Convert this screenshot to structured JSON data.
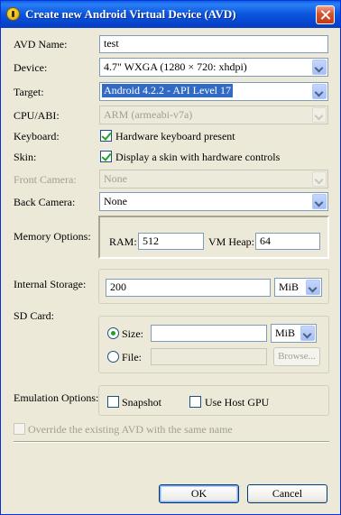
{
  "window": {
    "title": "Create new Android Virtual Device (AVD)"
  },
  "avd_name": {
    "label": "AVD Name:",
    "value": "test"
  },
  "device": {
    "label": "Device:",
    "value": "4.7\" WXGA (1280 × 720: xhdpi)"
  },
  "target": {
    "label": "Target:",
    "value": "Android 4.2.2 - API Level 17"
  },
  "cpu_abi": {
    "label": "CPU/ABI:",
    "value": "ARM (armeabi-v7a)"
  },
  "keyboard": {
    "label": "Keyboard:",
    "option": "Hardware keyboard present",
    "checked": true
  },
  "skin": {
    "label": "Skin:",
    "option": "Display a skin with hardware controls",
    "checked": true
  },
  "front_camera": {
    "label": "Front Camera:",
    "value": "None"
  },
  "back_camera": {
    "label": "Back Camera:",
    "value": "None"
  },
  "memory": {
    "label": "Memory Options:",
    "ram_label": "RAM:",
    "ram_value": "512",
    "heap_label": "VM Heap:",
    "heap_value": "64"
  },
  "internal_storage": {
    "label": "Internal Storage:",
    "value": "200",
    "unit": "MiB"
  },
  "sd_card": {
    "label": "SD Card:",
    "size_label": "Size:",
    "size_value": "",
    "size_unit": "MiB",
    "file_label": "File:",
    "file_value": "",
    "browse_label": "Browse...",
    "selected": "size"
  },
  "emulation": {
    "label": "Emulation Options:",
    "snapshot_label": "Snapshot",
    "snapshot_checked": false,
    "gpu_label": "Use Host GPU",
    "gpu_checked": false
  },
  "override": {
    "label": "Override the existing AVD with the same name",
    "checked": false
  },
  "buttons": {
    "ok": "OK",
    "cancel": "Cancel"
  }
}
